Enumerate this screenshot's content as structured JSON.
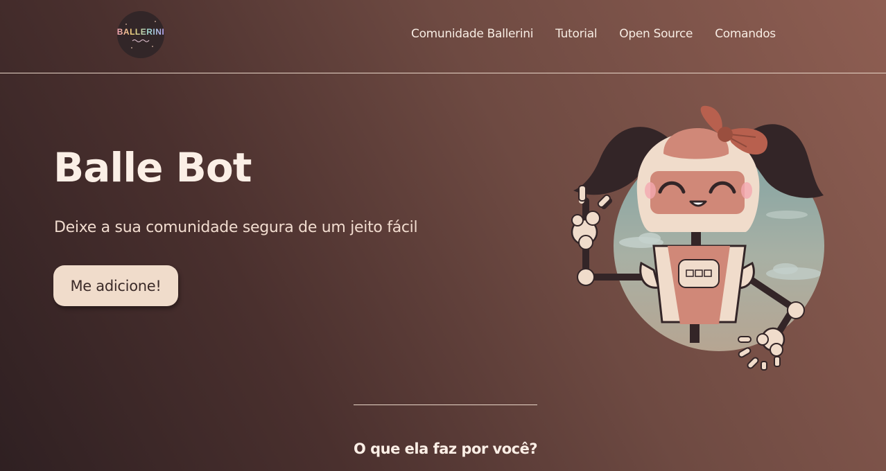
{
  "header": {
    "logo_text": "BALLERINI",
    "nav": [
      {
        "label": "Comunidade Ballerini"
      },
      {
        "label": "Tutorial"
      },
      {
        "label": "Open Source"
      },
      {
        "label": "Comandos"
      }
    ]
  },
  "hero": {
    "title": "Balle Bot",
    "subtitle": "Deixe a sua comunidade segura de um jeito fácil",
    "cta_label": "Me adicione!",
    "illustration": "robot-girl-mascot"
  },
  "section": {
    "title": "O que ela faz por você?"
  },
  "colors": {
    "background_dark": "#2f2022",
    "background_light": "#8e5e52",
    "button": "#f0dccb",
    "robot_body": "#f0dccb",
    "robot_accent": "#d08878",
    "robot_hair": "#332527"
  }
}
